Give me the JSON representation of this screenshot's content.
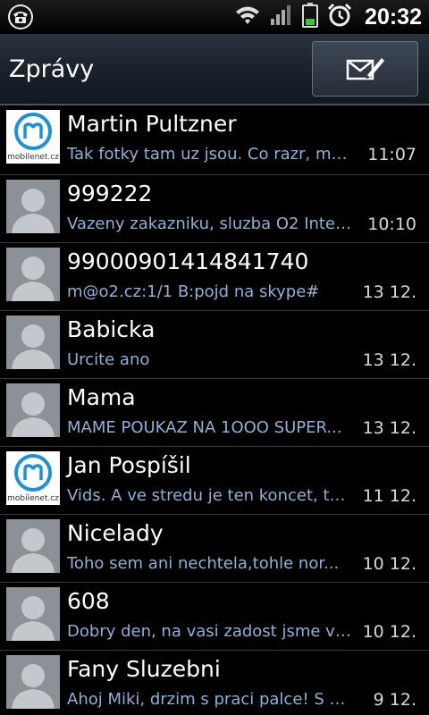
{
  "statusbar": {
    "time": "20:32",
    "icons": [
      "voicemail-icon",
      "wifi-icon",
      "signal-icon",
      "battery-icon",
      "alarm-icon"
    ]
  },
  "header": {
    "title": "Zprávy",
    "compose_icon": "compose-message-icon"
  },
  "threads": [
    {
      "name": "Martin Pultzner",
      "preview": "Tak fotky tam uz jsou. Co razr, ma...",
      "time": "11:07",
      "avatar": "mobilenet-logo"
    },
    {
      "name": "999222",
      "preview": "Vazeny zakazniku, sluzba O2 Inter...",
      "time": "10:10",
      "avatar": "person"
    },
    {
      "name": "99000901414841740",
      "preview": "m@o2.cz:1/1 B:pojd na skype#",
      "time": "13 12.",
      "avatar": "person"
    },
    {
      "name": "Babicka",
      "preview": "Urcite ano",
      "time": "13 12.",
      "avatar": "person"
    },
    {
      "name": "Mama",
      "preview": "MAME POUKAZ NA 1OOO SUPER...",
      "time": "13 12.",
      "avatar": "person"
    },
    {
      "name": "Jan Pospíšil",
      "preview": "Vids. A ve stredu je ten koncet, ta...",
      "time": "11 12.",
      "avatar": "mobilenet-logo"
    },
    {
      "name": "Nicelady",
      "preview": "Toho sem ani nechtela,tohle nor...",
      "time": "10 12.",
      "avatar": "person"
    },
    {
      "name": "608",
      "preview": "Dobry den, na vasi zadost jsme va...",
      "time": "10 12.",
      "avatar": "person"
    },
    {
      "name": "Fany Sluzebni",
      "preview": "Ahoj Miki, drzim s praci palce! S byt...",
      "time": "9 12.",
      "avatar": "person"
    }
  ],
  "logo": {
    "text": "mobilenet.cz",
    "color": "#1e90d6"
  },
  "colors": {
    "preview": "#8fb0d8",
    "title_bg": "#1a222c",
    "divider": "#3a3a3a"
  }
}
